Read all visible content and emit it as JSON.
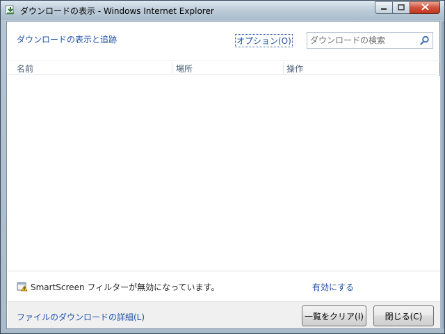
{
  "window": {
    "title": "ダウンロードの表示 - Windows Internet Explorer",
    "icon": "ie-download-icon"
  },
  "header": {
    "title": "ダウンロードの表示と追跡",
    "options_label": "オプション(O)",
    "search_placeholder": "ダウンロードの検索"
  },
  "list": {
    "columns": [
      "名前",
      "場所",
      "操作"
    ],
    "rows": []
  },
  "smartscreen": {
    "message": "SmartScreen フィルターが無効になっています。",
    "enable_label": "有効にする"
  },
  "footer": {
    "details_link": "ファイルのダウンロードの詳細(L)",
    "clear_label": "一覧をクリア(I)",
    "close_label": "閉じる(C)"
  },
  "colors": {
    "link": "#1f50a8",
    "close_button": "#c0381f"
  }
}
